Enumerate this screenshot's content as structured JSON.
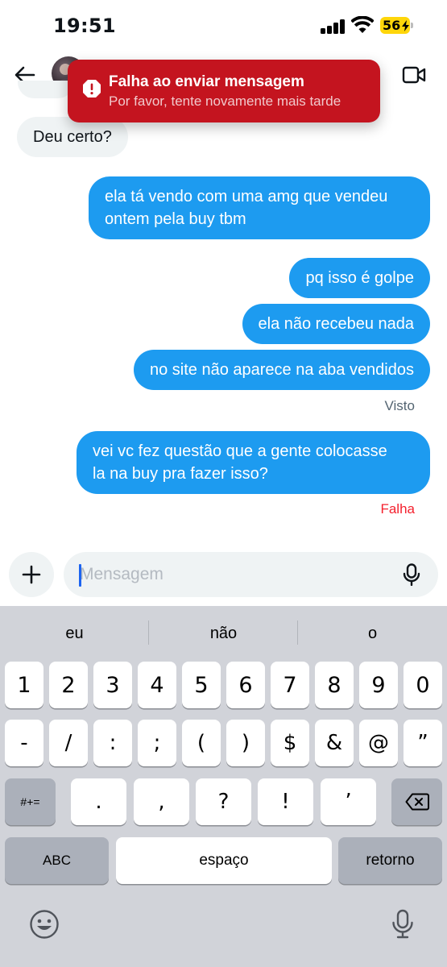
{
  "status_bar": {
    "time": "19:51",
    "battery": "56"
  },
  "header": {},
  "toast": {
    "title": "Falha ao enviar mensagem",
    "subtitle": "Por favor, tente novamente mais tarde",
    "color": "#c4141f"
  },
  "messages": [
    {
      "direction": "incoming",
      "lines": [
        "Deu certo?"
      ]
    },
    {
      "direction": "outgoing",
      "lines": [
        "ela tá vendo com uma amg que vendeu",
        "ontem pela buy tbm"
      ]
    },
    {
      "direction": "outgoing",
      "lines": [
        "pq isso é golpe"
      ]
    },
    {
      "direction": "outgoing",
      "lines": [
        "ela não recebeu nada"
      ]
    },
    {
      "direction": "outgoing",
      "lines": [
        "no site não aparece na aba vendidos"
      ]
    },
    {
      "direction": "outgoing",
      "lines": [
        "vei vc fez questão que a gente colocasse",
        "la na buy pra fazer isso?"
      ]
    }
  ],
  "seen_label": "Visto",
  "failed_label": "Falha",
  "composer": {
    "placeholder": "Mensagem",
    "value": ""
  },
  "keyboard": {
    "suggestions": [
      "eu",
      "não",
      "o"
    ],
    "row1": [
      "1",
      "2",
      "3",
      "4",
      "5",
      "6",
      "7",
      "8",
      "9",
      "0"
    ],
    "row2": [
      "-",
      "/",
      ":",
      ";",
      "(",
      ")",
      "$",
      "&",
      "@",
      "”"
    ],
    "row3_toggle": "#+=",
    "row3": [
      ".",
      ",",
      "?",
      "!",
      "’"
    ],
    "abc": "ABC",
    "space": "espaço",
    "return": "retorno"
  },
  "colors": {
    "outgoing": "#1d9bf0",
    "incoming": "#eff3f4",
    "failed": "#f4212e",
    "keyboard_bg": "#d1d3d9"
  },
  "icons": [
    "back-arrow-icon",
    "video-camera-icon",
    "alert-icon",
    "plus-icon",
    "microphone-icon",
    "backspace-icon",
    "emoji-icon",
    "dictation-microphone-icon"
  ]
}
